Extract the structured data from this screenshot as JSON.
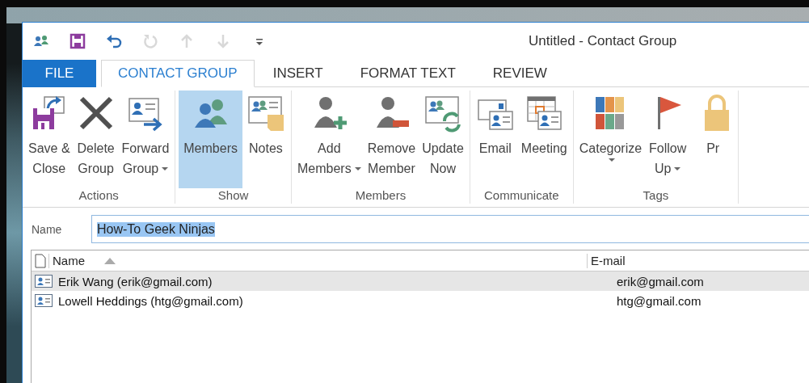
{
  "window": {
    "title": "Untitled - Contact Group"
  },
  "quick_access": [
    {
      "kind": "contacts",
      "disabled": false
    },
    {
      "kind": "save",
      "disabled": false
    },
    {
      "kind": "undo",
      "disabled": false
    },
    {
      "kind": "redo",
      "disabled": true
    },
    {
      "kind": "up",
      "disabled": true
    },
    {
      "kind": "down",
      "disabled": true
    },
    {
      "kind": "customize",
      "disabled": false
    }
  ],
  "tabs": [
    {
      "label": "FILE",
      "kind": "file",
      "selected": false
    },
    {
      "label": "CONTACT GROUP",
      "kind": "tab",
      "selected": true
    },
    {
      "label": "INSERT",
      "kind": "tab",
      "selected": false
    },
    {
      "label": "FORMAT TEXT",
      "kind": "tab",
      "selected": false
    },
    {
      "label": "REVIEW",
      "kind": "tab",
      "selected": false
    }
  ],
  "ribbon": {
    "groups": [
      {
        "label": "Actions",
        "buttons": [
          {
            "kind": "save-close",
            "lines": [
              "Save &",
              "Close"
            ],
            "dropdown": false,
            "selected": false
          },
          {
            "kind": "delete",
            "lines": [
              "Delete",
              "Group"
            ],
            "dropdown": false,
            "selected": false
          },
          {
            "kind": "forward",
            "lines": [
              "Forward",
              "Group"
            ],
            "dropdown": true,
            "selected": false
          }
        ]
      },
      {
        "label": "Show",
        "buttons": [
          {
            "kind": "members",
            "lines": [
              "Members"
            ],
            "dropdown": false,
            "selected": true
          },
          {
            "kind": "notes",
            "lines": [
              "Notes"
            ],
            "dropdown": false,
            "selected": false
          }
        ]
      },
      {
        "label": "Members",
        "buttons": [
          {
            "kind": "add-member",
            "lines": [
              "Add",
              "Members"
            ],
            "dropdown": true,
            "selected": false
          },
          {
            "kind": "remove-member",
            "lines": [
              "Remove",
              "Member"
            ],
            "dropdown": false,
            "selected": false
          },
          {
            "kind": "update",
            "lines": [
              "Update",
              "Now"
            ],
            "dropdown": false,
            "selected": false
          }
        ]
      },
      {
        "label": "Communicate",
        "buttons": [
          {
            "kind": "email",
            "lines": [
              "Email"
            ],
            "dropdown": false,
            "selected": false
          },
          {
            "kind": "meeting",
            "lines": [
              "Meeting"
            ],
            "dropdown": false,
            "selected": false
          }
        ]
      },
      {
        "label": "Tags",
        "buttons": [
          {
            "kind": "categorize",
            "lines": [
              "Categorize"
            ],
            "dropdown": true,
            "selected": false
          },
          {
            "kind": "follow-up",
            "lines": [
              "Follow",
              "Up"
            ],
            "dropdown": true,
            "selected": false
          },
          {
            "kind": "private",
            "lines": [
              "Pr"
            ],
            "dropdown": false,
            "selected": false
          }
        ]
      }
    ]
  },
  "name_field": {
    "label": "Name",
    "value": "How-To Geek Ninjas",
    "value_selected": true
  },
  "members_list": {
    "columns": [
      {
        "label": "Name",
        "sorted": true
      },
      {
        "label": "E-mail",
        "sorted": false
      }
    ],
    "rows": [
      {
        "name": "Erik Wang (erik@gmail.com)",
        "email": "erik@gmail.com",
        "selected": true
      },
      {
        "name": "Lowell Heddings (htg@gmail.com)",
        "email": "htg@gmail.com",
        "selected": false
      }
    ]
  }
}
